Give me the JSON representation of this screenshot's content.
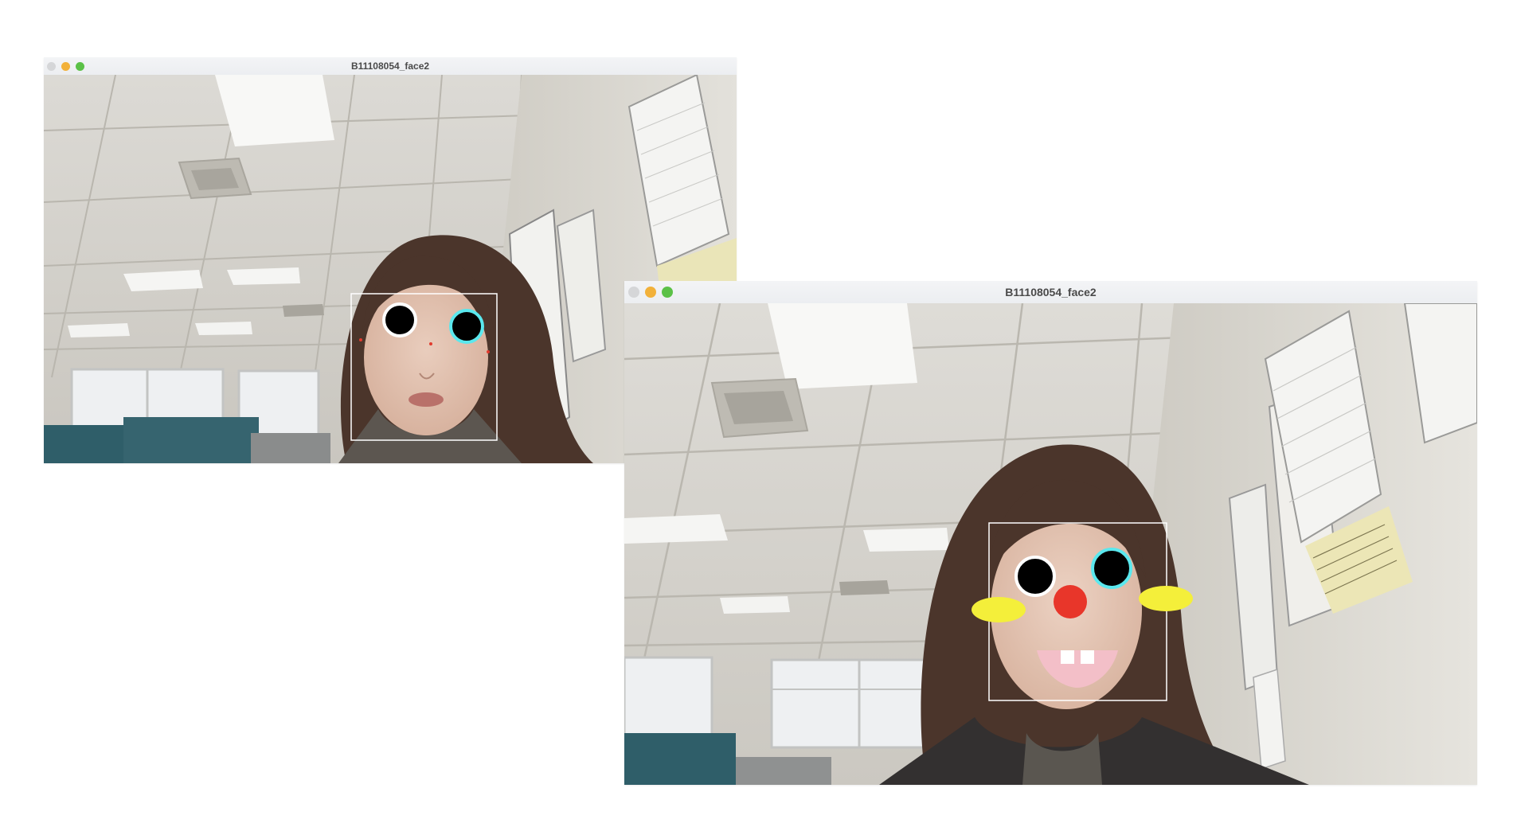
{
  "windows": [
    {
      "title": "B11108054_face2"
    },
    {
      "title": "B11108054_face2"
    }
  ],
  "colors": {
    "close_inactive": "#d5d6d8",
    "minimize": "#f2b13a",
    "zoom": "#5bc147",
    "face_box": "#ffffff",
    "left_eye_ring": "#ffffff",
    "right_eye_ring": "#5ae8ee",
    "nose": "#e8362a",
    "cheek": "#f4ef3a",
    "mouth": "#f3bfc8",
    "tooth": "#ffffff"
  },
  "icons": [
    "close-dot-icon",
    "minimize-dot-icon",
    "zoom-dot-icon"
  ]
}
